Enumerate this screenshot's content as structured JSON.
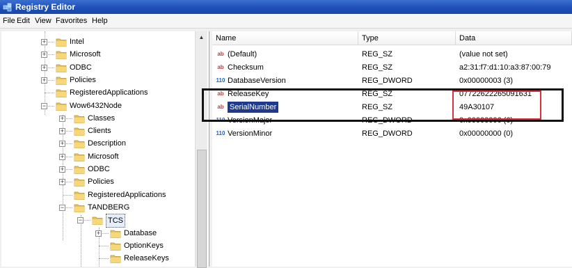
{
  "window": {
    "title": "Registry Editor"
  },
  "menu": [
    "File",
    "Edit",
    "View",
    "Favorites",
    "Help"
  ],
  "tree": [
    {
      "label": "Intel",
      "expander": "+"
    },
    {
      "label": "Microsoft",
      "expander": "+"
    },
    {
      "label": "ODBC",
      "expander": "+"
    },
    {
      "label": "Policies",
      "expander": "+"
    },
    {
      "label": "RegisteredApplications",
      "expander": ""
    },
    {
      "label": "Wow6432Node",
      "expander": "-"
    },
    {
      "label": "Classes",
      "expander": "+"
    },
    {
      "label": "Clients",
      "expander": "+"
    },
    {
      "label": "Description",
      "expander": "+"
    },
    {
      "label": "Microsoft",
      "expander": "+"
    },
    {
      "label": "ODBC",
      "expander": "+"
    },
    {
      "label": "Policies",
      "expander": "+"
    },
    {
      "label": "RegisteredApplications",
      "expander": ""
    },
    {
      "label": "TANDBERG",
      "expander": "-"
    },
    {
      "label": "TCS",
      "expander": "-"
    },
    {
      "label": "Database",
      "expander": "+"
    },
    {
      "label": "OptionKeys",
      "expander": ""
    },
    {
      "label": "ReleaseKeys",
      "expander": ""
    }
  ],
  "columns": {
    "name": "Name",
    "type": "Type",
    "data": "Data"
  },
  "values": [
    {
      "icon": "string-value-icon",
      "name": "(Default)",
      "type": "REG_SZ",
      "data": "(value not set)"
    },
    {
      "icon": "string-value-icon",
      "name": "Checksum",
      "type": "REG_SZ",
      "data": "a2:31:f7:d1:10:a3:87:00:79"
    },
    {
      "icon": "dword-value-icon",
      "name": "DatabaseVersion",
      "type": "REG_DWORD",
      "data": "0x00000003 (3)"
    },
    {
      "icon": "string-value-icon",
      "name": "ReleaseKey",
      "type": "REG_SZ",
      "data": "07722622265091631"
    },
    {
      "icon": "string-value-icon",
      "name": "SerialNumber",
      "type": "REG_SZ",
      "data": "49A30107"
    },
    {
      "icon": "dword-value-icon",
      "name": "VersionMajor",
      "type": "REG_DWORD",
      "data": "0x00000006 (6)"
    },
    {
      "icon": "dword-value-icon",
      "name": "VersionMinor",
      "type": "REG_DWORD",
      "data": "0x00000000 (0)"
    }
  ],
  "icon_labels": {
    "string": "ab",
    "dword": "110"
  },
  "colors": {
    "highlight_outer": "#111111",
    "highlight_inner": "#d9303a",
    "selection": "#1d3a8c"
  }
}
